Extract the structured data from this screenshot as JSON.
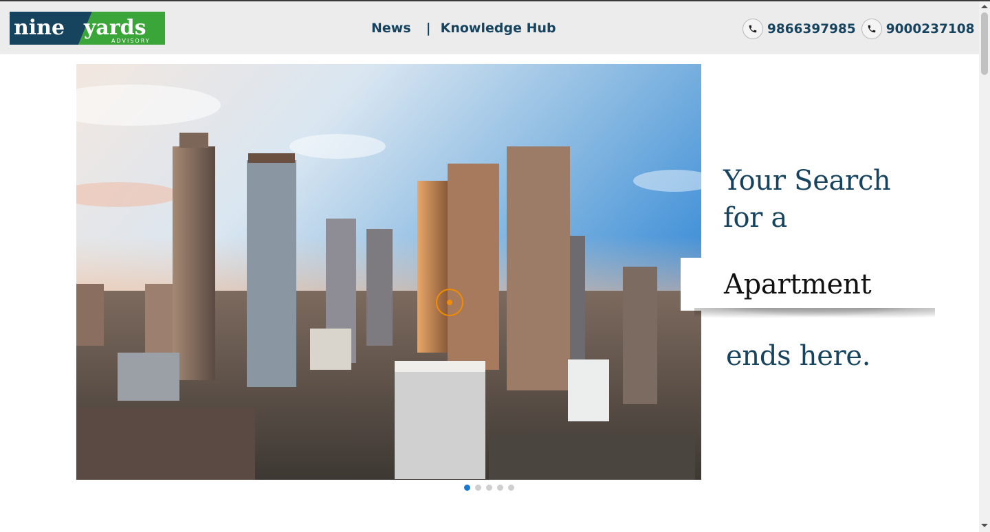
{
  "header": {
    "logo": {
      "part1": "nine",
      "part2": "yards",
      "subtitle": "ADVISORY",
      "colors": {
        "navy": "#16435e",
        "green": "#3aa63a"
      }
    },
    "nav": [
      {
        "label": "News"
      },
      {
        "label": "Knowledge Hub"
      }
    ],
    "nav_separator": "|",
    "phones": [
      {
        "icon": "phone-icon",
        "number": "9866397985"
      },
      {
        "icon": "phone-icon",
        "number": "9000237108"
      }
    ]
  },
  "hero": {
    "image_alt": "city skyline with high-rise towers",
    "tagline_line1": "Your Search",
    "tagline_line2": "for a",
    "highlight_word": "Apartment",
    "tagline_tail": "ends here.",
    "slide_count": 5,
    "active_slide": 1
  },
  "colors": {
    "brand_navy": "#16435e",
    "header_bg": "#edeced",
    "active_dot": "#1a78d6",
    "inactive_dot": "#cfcfcf"
  }
}
